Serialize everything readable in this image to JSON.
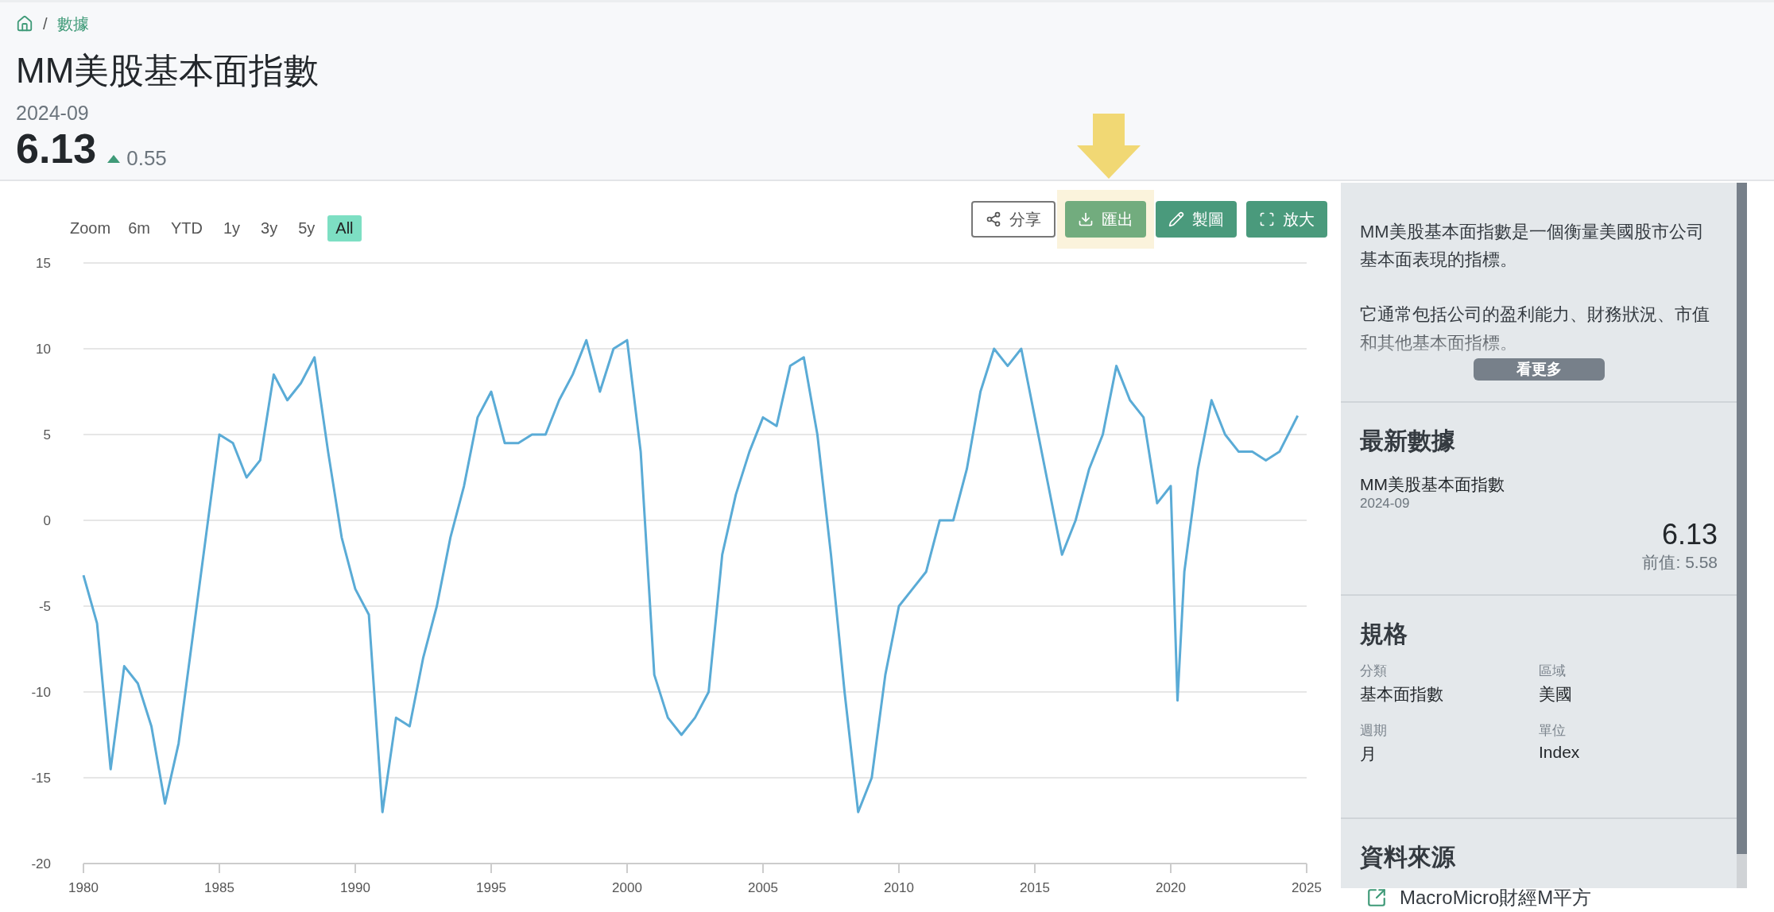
{
  "breadcrumb": {
    "separator": "/",
    "items": [
      "數據"
    ]
  },
  "header": {
    "title": "MM美股基本面指數",
    "date": "2024-09",
    "value": "6.13",
    "change": "0.55",
    "rising": true
  },
  "range_selector": {
    "label": "Zoom",
    "options": [
      {
        "label": "6m",
        "selected": false
      },
      {
        "label": "YTD",
        "selected": false
      },
      {
        "label": "1y",
        "selected": false
      },
      {
        "label": "3y",
        "selected": false
      },
      {
        "label": "5y",
        "selected": false
      },
      {
        "label": "All",
        "selected": true
      }
    ]
  },
  "actions": [
    {
      "label": "分享",
      "kind": "share",
      "highlighted": false
    },
    {
      "label": "匯出",
      "kind": "export",
      "highlighted": true
    },
    {
      "label": "製圖",
      "kind": "edit",
      "highlighted": false
    },
    {
      "label": "放大",
      "kind": "fullscreen",
      "highlighted": false
    }
  ],
  "chart": {
    "chart_data": {
      "type": "line",
      "grid": true,
      "xlim": [
        1980,
        2025
      ],
      "ylim": [
        -20,
        15
      ],
      "xticks": [
        1980,
        1985,
        1990,
        1995,
        2000,
        2005,
        2010,
        2015,
        2020,
        2025
      ],
      "yticks": [
        -20,
        -15,
        -10,
        -5,
        0,
        5,
        10,
        15
      ],
      "x": [
        1980,
        1980.5,
        1981,
        1981.5,
        1982,
        1982.5,
        1983,
        1983.5,
        1984,
        1984.5,
        1985,
        1985.5,
        1986,
        1986.5,
        1987,
        1987.5,
        1988,
        1988.5,
        1989,
        1989.5,
        1990,
        1990.5,
        1991,
        1991.5,
        1992,
        1992.5,
        1993,
        1993.5,
        1994,
        1994.5,
        1995,
        1995.5,
        1996,
        1996.5,
        1997,
        1997.5,
        1998,
        1998.5,
        1999,
        1999.5,
        2000,
        2000.5,
        2001,
        2001.5,
        2002,
        2002.5,
        2003,
        2003.5,
        2004,
        2004.5,
        2005,
        2005.5,
        2006,
        2006.5,
        2007,
        2007.5,
        2008,
        2008.5,
        2009,
        2009.5,
        2010,
        2010.5,
        2011,
        2011.5,
        2012,
        2012.5,
        2013,
        2013.5,
        2014,
        2014.5,
        2015,
        2015.5,
        2016,
        2016.5,
        2017,
        2017.5,
        2018,
        2018.5,
        2019,
        2019.5,
        2020,
        2020.25,
        2020.5,
        2021,
        2021.5,
        2022,
        2022.5,
        2023,
        2023.5,
        2024,
        2024.67
      ],
      "series": [
        {
          "color": "#5aabd6",
          "values": [
            -3.2,
            -6,
            -14.5,
            -8.5,
            -9.5,
            -12,
            -16.5,
            -13,
            -7,
            -1,
            5,
            4.5,
            2.5,
            3.5,
            8.5,
            7,
            8,
            9.5,
            4,
            -1,
            -4,
            -5.5,
            -17,
            -11.5,
            -12,
            -8,
            -5,
            -1,
            2,
            6,
            7.5,
            4.5,
            4.5,
            5,
            5,
            7,
            8.5,
            10.5,
            7.5,
            10,
            10.5,
            4,
            -9,
            -11.5,
            -12.5,
            -11.5,
            -10,
            -2,
            1.5,
            4,
            6,
            5.5,
            9,
            9.5,
            5,
            -2,
            -10,
            -17,
            -15,
            -9,
            -5,
            -4,
            -3,
            0,
            0,
            3,
            7.5,
            10,
            9,
            10,
            6,
            2,
            -2,
            0,
            3,
            5,
            9,
            7,
            6,
            1,
            2,
            -10.5,
            -3,
            3,
            7,
            5,
            4,
            4,
            3.5,
            4,
            6.1
          ]
        }
      ]
    }
  },
  "panel": {
    "description": [
      "MM美股基本面指數是一個衡量美國股市公司基本面表現的指標。",
      "它通常包括公司的盈利能力、財務狀況、市值和其他基本面指標。"
    ],
    "more_button": "看更多",
    "latest": {
      "heading": "最新數據",
      "name": "MM美股基本面指數",
      "date": "2024-09",
      "value": "6.13",
      "previous_label": "前值:",
      "previous": "5.58"
    },
    "specs": {
      "heading": "規格",
      "items": [
        {
          "label": "分類",
          "value": "基本面指數"
        },
        {
          "label": "區域",
          "value": "美國"
        },
        {
          "label": "週期",
          "value": "月"
        },
        {
          "label": "單位",
          "value": "Index"
        }
      ]
    },
    "source": {
      "heading": "資料來源",
      "link": "MacroMicro財經M平方"
    }
  }
}
